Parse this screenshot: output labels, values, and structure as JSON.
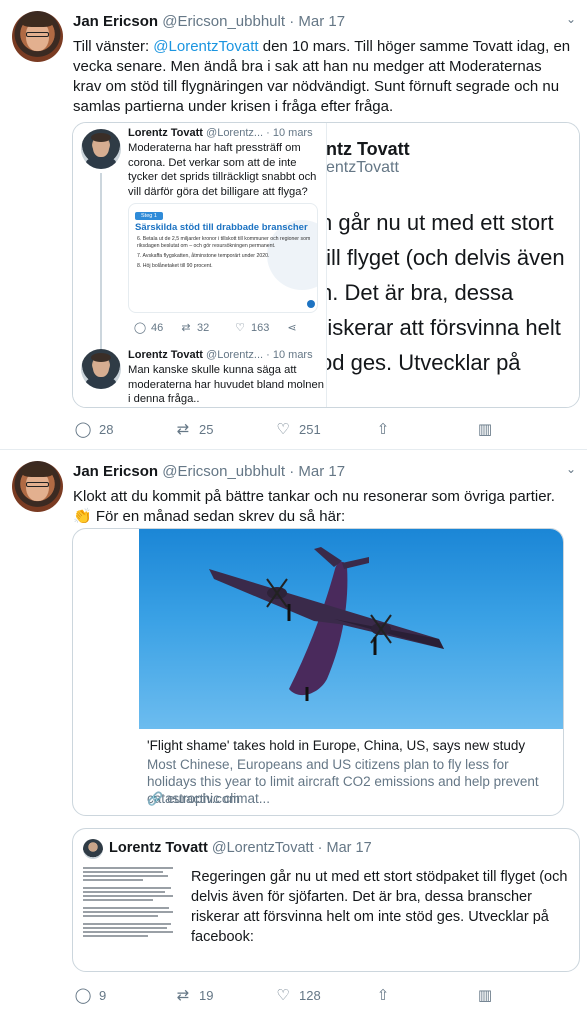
{
  "tweets": [
    {
      "author_name": "Jan Ericson",
      "author_handle": "@Ericson_ubbhult",
      "separator": "·",
      "date": "Mar 17",
      "text_before_mention": "Till vänster: ",
      "mention": "@LorentzTovatt",
      "text_after_mention": " den 10 mars. Till höger samme Tovatt idag, en vecka senare. Men ändå bra i sak att han nu medger att Moderaternas krav om stöd till flygnäringen var nödvändigt. Sunt förnuft segrade och nu samlas partierna under krisen i fråga efter fråga.",
      "quote": {
        "right_name": "ntz Tovatt",
        "right_handle": "entzTovatt",
        "right_body_lines": [
          "n går nu ut med ett stort",
          "till flyget (och delvis även",
          "n. Det är bra, dessa",
          "riskerar att försvinna helt",
          "od ges. Utvecklar på"
        ],
        "thread": [
          {
            "name": "Lorentz Tovatt",
            "handle": "@Lorentz...",
            "date": "10 mars",
            "text": "Moderaterna har haft pressträff om corona. Det verkar som att de inte tycker det sprids tillräckligt snabbt och vill därför göra det billigare att flyga?"
          },
          {
            "name": "Lorentz Tovatt",
            "handle": "@Lorentz...",
            "date": "10 mars",
            "text": "Man kanske skulle kunna säga att moderaterna har huvudet bland molnen i denna fråga.."
          }
        ],
        "image": {
          "tag": "Steg 1",
          "title": "Särskilda stöd till drabbade branscher",
          "items": [
            "6.  Betala ut de 2,5 miljarder kronor i tillskott till kommuner och regioner som riksdagen beslutat om – och gör resursökningen permanent.",
            "7.  Avskaffa flygskatten, åtminstone temporärt under 2020.",
            "8.  Höj bolånetaket till 90 procent."
          ]
        },
        "inner_actions": {
          "replies": "46",
          "retweets": "32",
          "likes": "163"
        }
      },
      "actions": {
        "replies": "28",
        "retweets": "25",
        "likes": "251"
      }
    },
    {
      "author_name": "Jan Ericson",
      "author_handle": "@Ericson_ubbhult",
      "separator": "·",
      "date": "Mar 17",
      "text_line1": "Klokt att du kommit på bättre tankar och nu resonerar som övriga partier.",
      "emoji": "👏",
      "text_line2": " För en månad sedan skrev du så här:",
      "link_card": {
        "title": "'Flight shame' takes hold in Europe, China, US, says new study",
        "description": "Most Chinese, Europeans and US citizens plan to fly less for holidays this year to limit aircraft CO2 emissions and help prevent catastrophic climat...",
        "domain": "euractiv.com"
      },
      "quote": {
        "name": "Lorentz Tovatt",
        "handle": "@LorentzTovatt",
        "date": "Mar 17",
        "text": "Regeringen går nu ut med ett stort stödpaket till flyget (och delvis även för sjöfarten. Det är bra, dessa branscher riskerar att försvinna helt om inte stöd ges. Utvecklar på facebook:"
      },
      "actions": {
        "replies": "9",
        "retweets": "19",
        "likes": "128"
      }
    }
  ],
  "icons": {
    "reply": "reply-icon",
    "retweet": "retweet-icon",
    "like": "heart-icon",
    "share": "share-icon",
    "analytics": "analytics-icon",
    "caret": "chevron-down-icon"
  },
  "colors": {
    "link": "#1b95e0",
    "secondary": "#657786",
    "border": "#ccd6dd",
    "sky": "#3aa1e5",
    "plane": "#4a2a5c"
  }
}
